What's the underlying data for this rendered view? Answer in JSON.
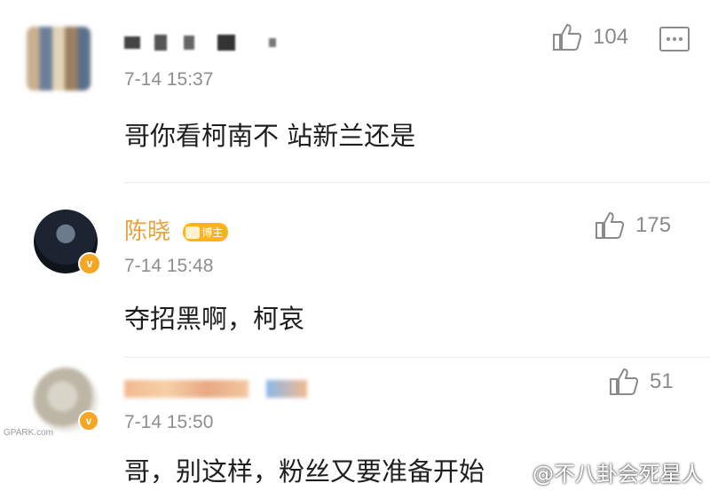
{
  "comments": [
    {
      "username": "",
      "time": "7-14 15:37",
      "text": "哥你看柯南不 站新兰还是",
      "likes": "104"
    },
    {
      "username": "陈晓",
      "badge": "博主",
      "time": "7-14 15:48",
      "text": "夺招黑啊，柯哀",
      "likes": "175"
    },
    {
      "username": "",
      "time": "7-14 15:50",
      "text": "哥，别这样，粉丝又要准备开始",
      "likes": "51"
    }
  ],
  "watermark": {
    "site": "@不八卦会死星人",
    "corner": "GPARK.com"
  },
  "colors": {
    "vip_name": "#e8a33d",
    "badge": "#ffb31a",
    "meta": "#8e8e8e"
  },
  "icons": {
    "like": "thumbs-up-icon",
    "reply": "comment-bubble-icon",
    "verified": "verified-v-icon"
  }
}
